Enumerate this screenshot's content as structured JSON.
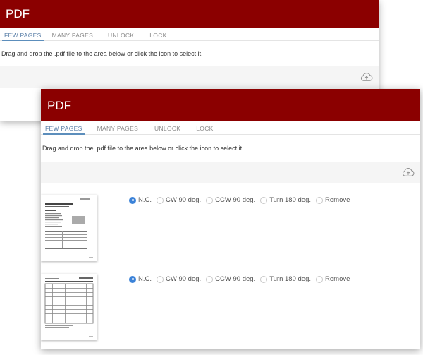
{
  "app": {
    "title": "PDF"
  },
  "tabs": [
    {
      "label": "FEW PAGES",
      "active": true
    },
    {
      "label": "MANY PAGES",
      "active": false
    },
    {
      "label": "UNLOCK",
      "active": false
    },
    {
      "label": "LOCK",
      "active": false
    }
  ],
  "instructions": "Drag and drop the .pdf file to the area below or click the icon to select it.",
  "upload": {
    "icon": "cloud-upload-icon"
  },
  "rotation_options": [
    "N.C.",
    "CW 90 deg.",
    "CCW 90 deg.",
    "Turn 180 deg.",
    "Remove"
  ],
  "files": [
    {
      "selected": "N.C.",
      "thumbnail": "page-thumbnail-icon"
    },
    {
      "selected": "N.C.",
      "thumbnail": "page-thumbnail-icon"
    }
  ],
  "colors": {
    "header": "#8b0000",
    "tab_active": "#5c8ebc",
    "radio_checked": "#3b82d8"
  }
}
